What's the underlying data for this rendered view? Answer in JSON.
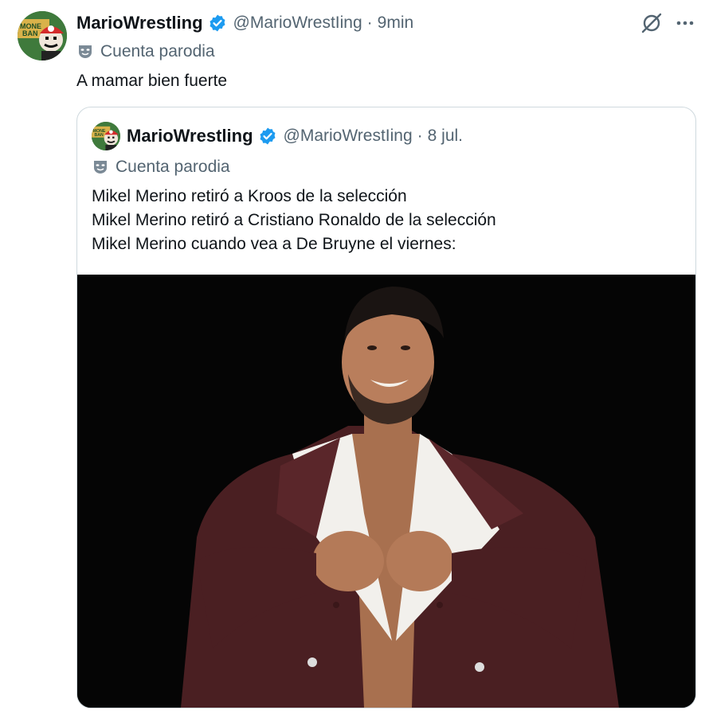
{
  "tweet": {
    "author_name": "MarioWrestling",
    "handle": "@MarioWrestIing",
    "separator": "·",
    "time": "9min",
    "parody_label": "Cuenta parodia",
    "text": "A mamar bien fuerte"
  },
  "quoted_tweet": {
    "author_name": "MarioWrestling",
    "handle": "@MarioWrestIing",
    "separator": "·",
    "time": "8 jul.",
    "parody_label": "Cuenta parodia",
    "lines": [
      "Mikel Merino retiró a Kroos de la selección",
      "Mikel Merino retiró a Cristiano Ronaldo de la selección",
      "Mikel Merino cuando vea a De Bruyne el viernes:"
    ]
  },
  "icons": {
    "verified": "verified-badge-icon",
    "parody": "parody-mask-icon",
    "grok": "grok-icon",
    "more": "more-options-icon"
  },
  "colors": {
    "verified_blue": "#1d9bf0",
    "secondary_text": "#536471",
    "media_background": "#050505",
    "jacket": "#4a1f22",
    "collar": "#f2f0ec"
  }
}
